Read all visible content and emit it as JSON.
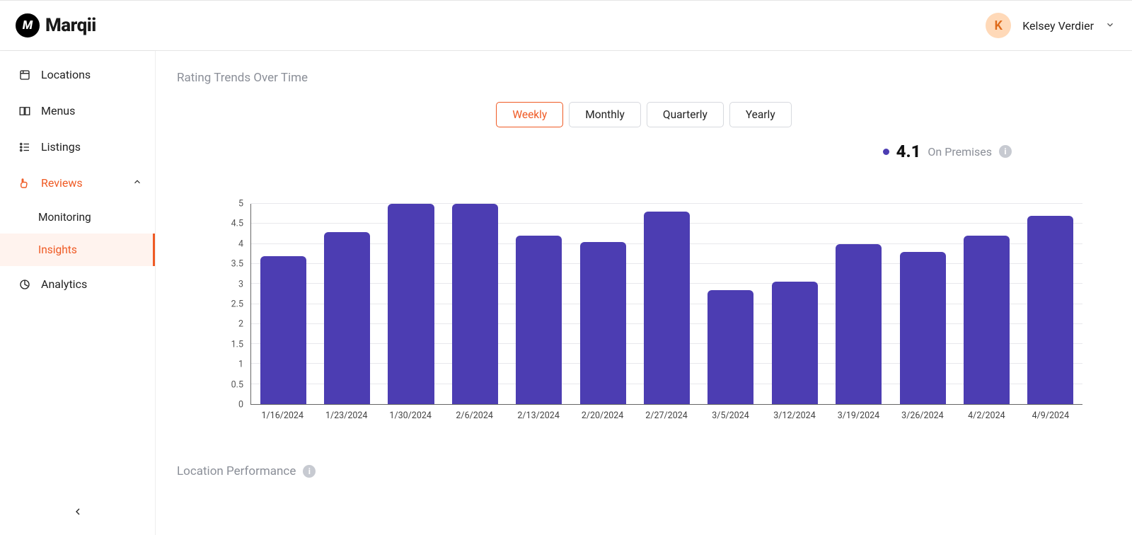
{
  "brand": {
    "name": "Marqii",
    "mark_letter": "M"
  },
  "user": {
    "initial": "K",
    "name": "Kelsey Verdier"
  },
  "sidebar": {
    "items": [
      {
        "label": "Locations",
        "icon": "locations-icon"
      },
      {
        "label": "Menus",
        "icon": "menus-icon"
      },
      {
        "label": "Listings",
        "icon": "listings-icon"
      },
      {
        "label": "Reviews",
        "icon": "reviews-icon",
        "active": true,
        "children": [
          {
            "label": "Monitoring"
          },
          {
            "label": "Insights",
            "active": true
          }
        ]
      },
      {
        "label": "Analytics",
        "icon": "analytics-icon"
      }
    ]
  },
  "sections": {
    "rating_trends_title": "Rating Trends Over Time",
    "location_performance_title": "Location Performance"
  },
  "range_tabs": {
    "weekly": "Weekly",
    "monthly": "Monthly",
    "quarterly": "Quarterly",
    "yearly": "Yearly",
    "selected": "weekly"
  },
  "legend": {
    "value": "4.1",
    "label": "On Premises"
  },
  "chart_data": {
    "type": "bar",
    "title": "Rating Trends Over Time",
    "xlabel": "",
    "ylabel": "",
    "ylim": [
      0,
      5
    ],
    "y_ticks": [
      0,
      0.5,
      1,
      1.5,
      2,
      2.5,
      3,
      3.5,
      4,
      4.5,
      5
    ],
    "categories": [
      "1/16/2024",
      "1/23/2024",
      "1/30/2024",
      "2/6/2024",
      "2/13/2024",
      "2/20/2024",
      "2/27/2024",
      "3/5/2024",
      "3/12/2024",
      "3/19/2024",
      "3/26/2024",
      "4/2/2024",
      "4/9/2024"
    ],
    "series": [
      {
        "name": "On Premises",
        "color": "#4c3db2",
        "values": [
          3.7,
          4.3,
          5.0,
          5.0,
          4.2,
          4.05,
          4.8,
          2.85,
          3.05,
          4.0,
          3.8,
          4.2,
          4.7
        ]
      }
    ]
  }
}
